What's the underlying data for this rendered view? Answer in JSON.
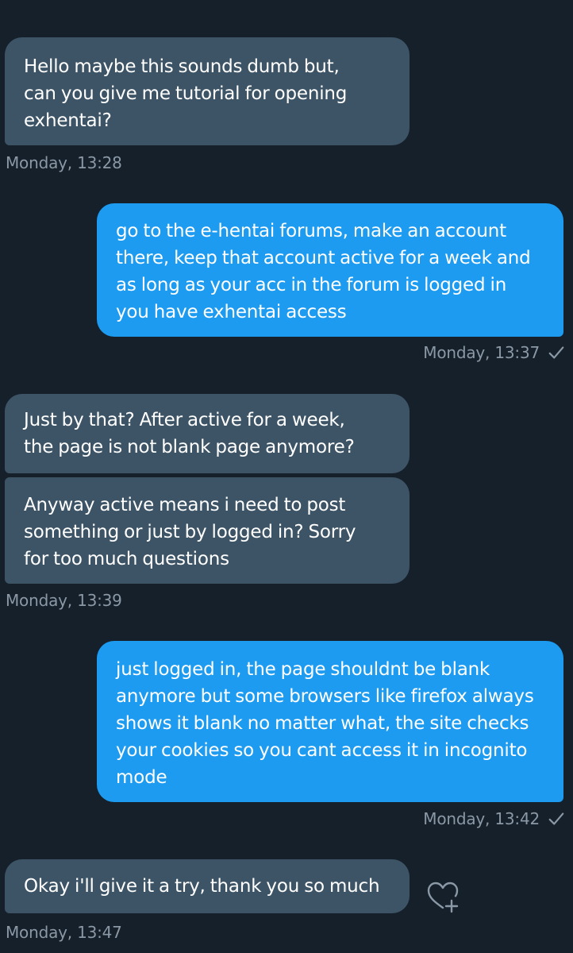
{
  "thread": {
    "messages": [
      {
        "direction": "received",
        "text": "Hello maybe this sounds dumb but,\ncan you give me tutorial for opening\nexhentai?"
      },
      {
        "direction": "received",
        "timestamp": "Monday, 13:28"
      },
      {
        "direction": "sent",
        "text": "go to the e-hentai forums, make an account\nthere, keep that account active for a week and\nas long as your acc in the forum is logged in\nyou have exhentai access"
      },
      {
        "direction": "sent",
        "timestamp": "Monday, 13:37",
        "status_icon": "check-icon"
      },
      {
        "direction": "received",
        "text": "Just by that? After active for a week,\nthe page is not blank page anymore?"
      },
      {
        "direction": "received",
        "text": "Anyway active means i need to post\nsomething or just by logged in? Sorry\nfor too much questions"
      },
      {
        "direction": "received",
        "timestamp": "Monday, 13:39"
      },
      {
        "direction": "sent",
        "text": "just logged in, the page shouldnt be blank\nanymore but some browsers like firefox always\nshows it blank no matter what, the site checks\nyour cookies so you cant access it in incognito\nmode"
      },
      {
        "direction": "sent",
        "timestamp": "Monday, 13:42",
        "status_icon": "check-icon"
      },
      {
        "direction": "received",
        "text": "Okay i'll give it a try, thank you so much",
        "reaction_icon": "heart-plus-icon"
      },
      {
        "direction": "received",
        "timestamp": "Monday, 13:47"
      }
    ]
  },
  "colors": {
    "background": "#15202b",
    "received_bubble": "#3d5466",
    "sent_bubble": "#1d9bf0",
    "timestamp_text": "#8b98a5"
  }
}
